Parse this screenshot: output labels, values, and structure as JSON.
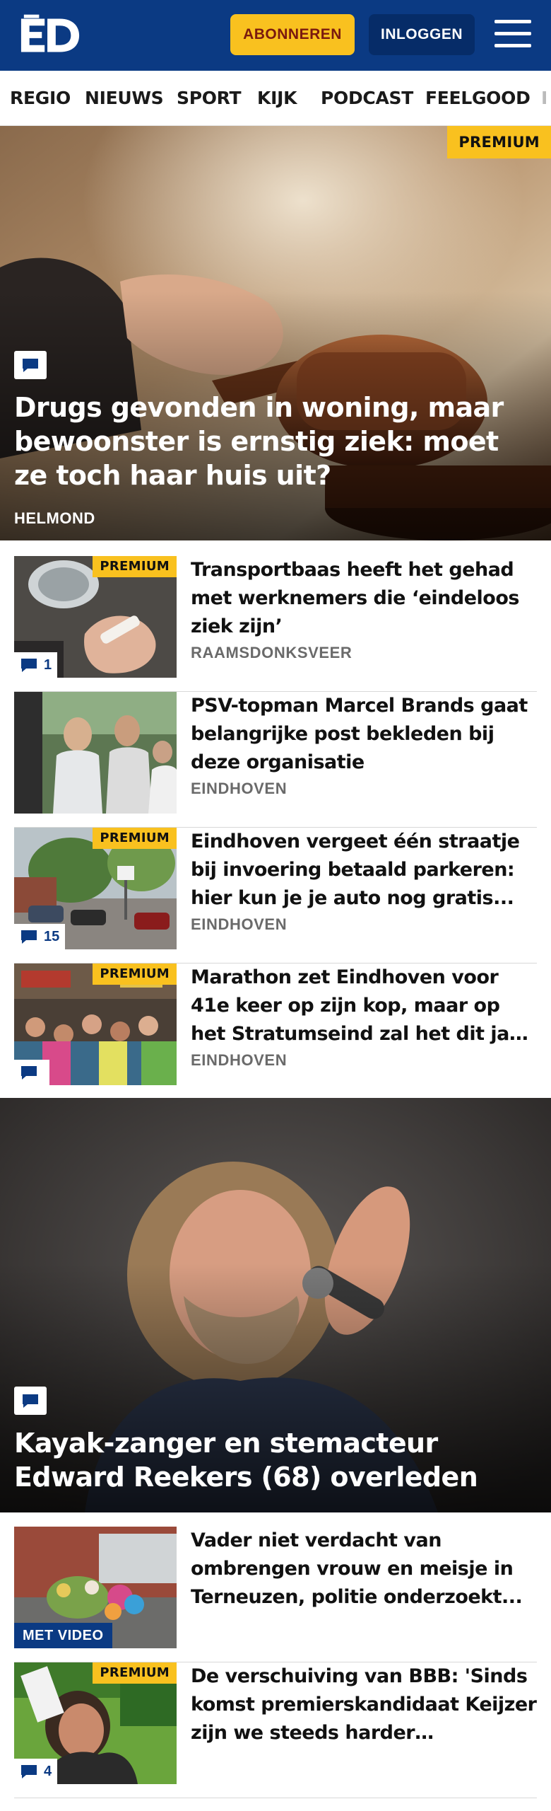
{
  "header": {
    "logo": "ED",
    "subscribe_label": "ABONNEREN",
    "login_label": "INLOGGEN",
    "menu_icon": "hamburger-menu-icon"
  },
  "nav": {
    "items": [
      "REGIO",
      "NIEUWS",
      "SPORT",
      "KIJK",
      "PODCAST",
      "FEELGOOD",
      "I"
    ]
  },
  "colors": {
    "brand_blue": "#0b3a83",
    "premium_yellow": "#f9c11f",
    "subscribe_text": "#7a1a0f"
  },
  "hero1": {
    "premium": "PREMIUM",
    "title": "Drugs gevonden in woning, maar bewoonster is ernstig ziek: moet ze toch haar huis uit?",
    "region": "HELMOND",
    "comment_icon": "comment-icon"
  },
  "articles_1": [
    {
      "title": "Transportbaas heeft het gehad met werknemers die ‘eindeloos ziek zijn’",
      "region": "RAAMSDONKSVEER",
      "premium": "PREMIUM",
      "comments": "1"
    },
    {
      "title": "PSV-topman Marcel Brands gaat belangrijke post bekleden bij deze organisatie",
      "region": "EINDHOVEN"
    },
    {
      "title": "Eindhoven vergeet één straatje bij invoering betaald parkeren: hier kun je je auto nog gratis...",
      "region": "EINDHOVEN",
      "premium": "PREMIUM",
      "comments": "15"
    },
    {
      "title": "Marathon zet Eindhoven voor 41e keer op zijn kop, maar op het Stratumseind zal het dit jaar wa...",
      "region": "EINDHOVEN",
      "premium": "PREMIUM",
      "comments": ""
    }
  ],
  "hero2": {
    "title": "Kayak-zanger en stemacteur Edward Reekers (68) overleden",
    "comment_icon": "comment-icon"
  },
  "articles_2": [
    {
      "title": "Vader niet verdacht van ombrengen vrouw en meisje in Terneuzen, politie onderzoekt...",
      "video": "MET VIDEO"
    },
    {
      "title": "De verschuiving van BBB: 'Sinds komst premierskandidaat Keijzer zijn we steeds harder geworden...",
      "premium": "PREMIUM",
      "comments": "4"
    }
  ]
}
